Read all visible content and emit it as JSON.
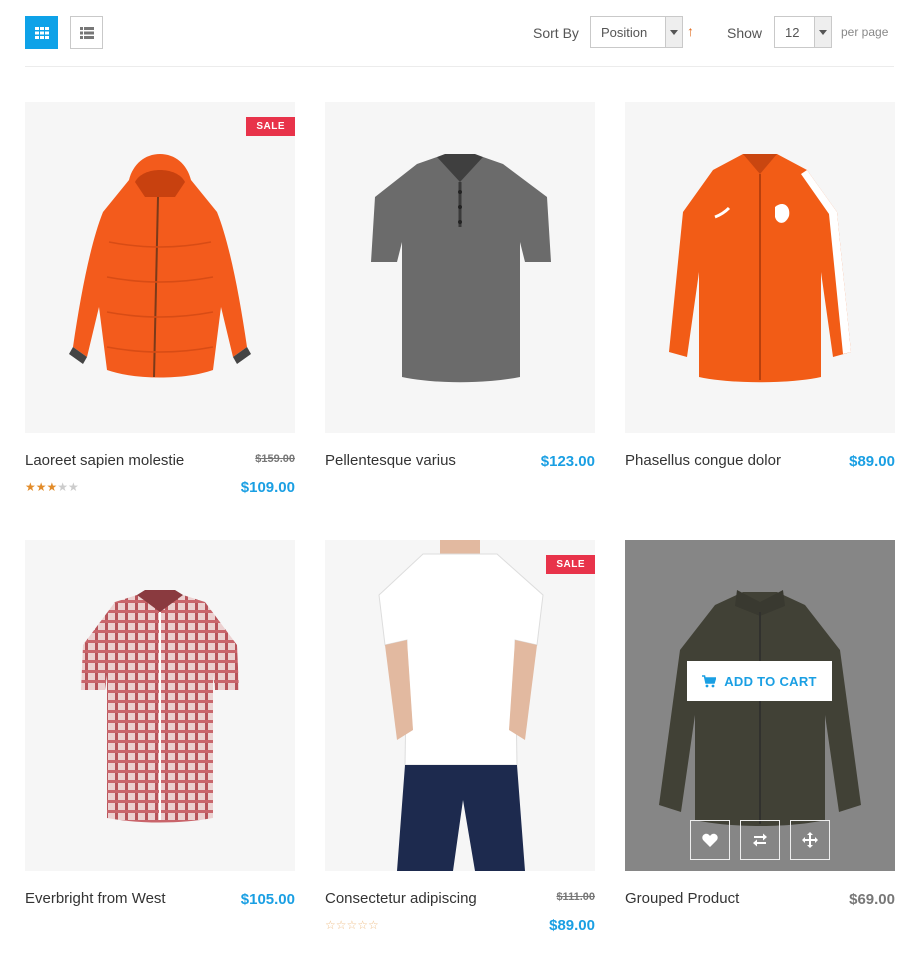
{
  "toolbar": {
    "sort_label": "Sort By",
    "sort_value": "Position",
    "sort_direction": "↑",
    "show_label": "Show",
    "show_value": "12",
    "per_page": "per page",
    "grid_view_icon": "grid-icon",
    "list_view_icon": "list-icon"
  },
  "colors": {
    "accent": "#0ea2e8",
    "price": "#1a9fe3",
    "sale_badge": "#e8334a",
    "star": "#e28c2a"
  },
  "products": [
    {
      "name": "Laoreet sapien molestie",
      "old_price": "$159.00",
      "price": "$109.00",
      "badge": "SALE",
      "rating": 3
    },
    {
      "name": "Pellentesque varius",
      "price": "$123.00"
    },
    {
      "name": "Phasellus congue dolor",
      "price": "$89.00"
    },
    {
      "name": "Everbright from West",
      "price": "$105.00"
    },
    {
      "name": "Consectetur adipiscing",
      "old_price": "$111.00",
      "price": "$89.00",
      "badge": "SALE",
      "rating": 0
    },
    {
      "name": "Grouped Product",
      "price": "$69.00",
      "add_to_cart": "ADD TO CART",
      "actions": [
        "heart-icon",
        "compare-icon",
        "move-icon"
      ]
    }
  ]
}
